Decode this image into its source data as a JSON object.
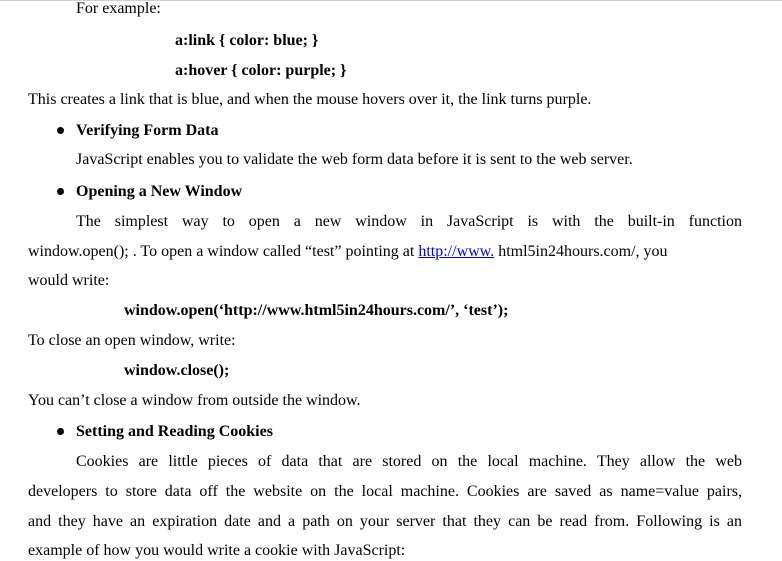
{
  "doc": {
    "for_example": "For example:",
    "code_link": "a:link { color: blue; }",
    "code_hover": "a:hover { color: purple; }",
    "link_explain": "This creates a link that is blue, and when the mouse hovers over it, the link turns purple.",
    "bullet_form": "Verifying Form Data",
    "form_text": "JavaScript enables you to validate the web form data before it is sent to the web server.",
    "bullet_window": "Opening a New Window",
    "window_text_1": "The simplest way to open a new window in JavaScript is with the built-in function",
    "window_text_2a": "window.open(); . To open a window called “test” pointing at ",
    "window_link": "http://www.",
    "window_text_2b": " html5in24hours.com/, you",
    "window_text_3": "would write:",
    "code_open": "window.open(‘http://www.html5in24hours.com/’, ‘test’);",
    "close_intro": "To close an open window, write:",
    "code_close": "window.close();",
    "close_note": "You can’t close a window from outside the window.",
    "bullet_cookies": "Setting and Reading Cookies",
    "cookies_1": "Cookies are little pieces of data that are stored on the local machine. They allow the web",
    "cookies_2": "developers to store data off the website on the local machine. Cookies are saved as name=value pairs,",
    "cookies_3": "and they have an expiration date and a path on your server that they can be read from. Following is an",
    "cookies_4": "example of how you would write a cookie with JavaScript:"
  }
}
